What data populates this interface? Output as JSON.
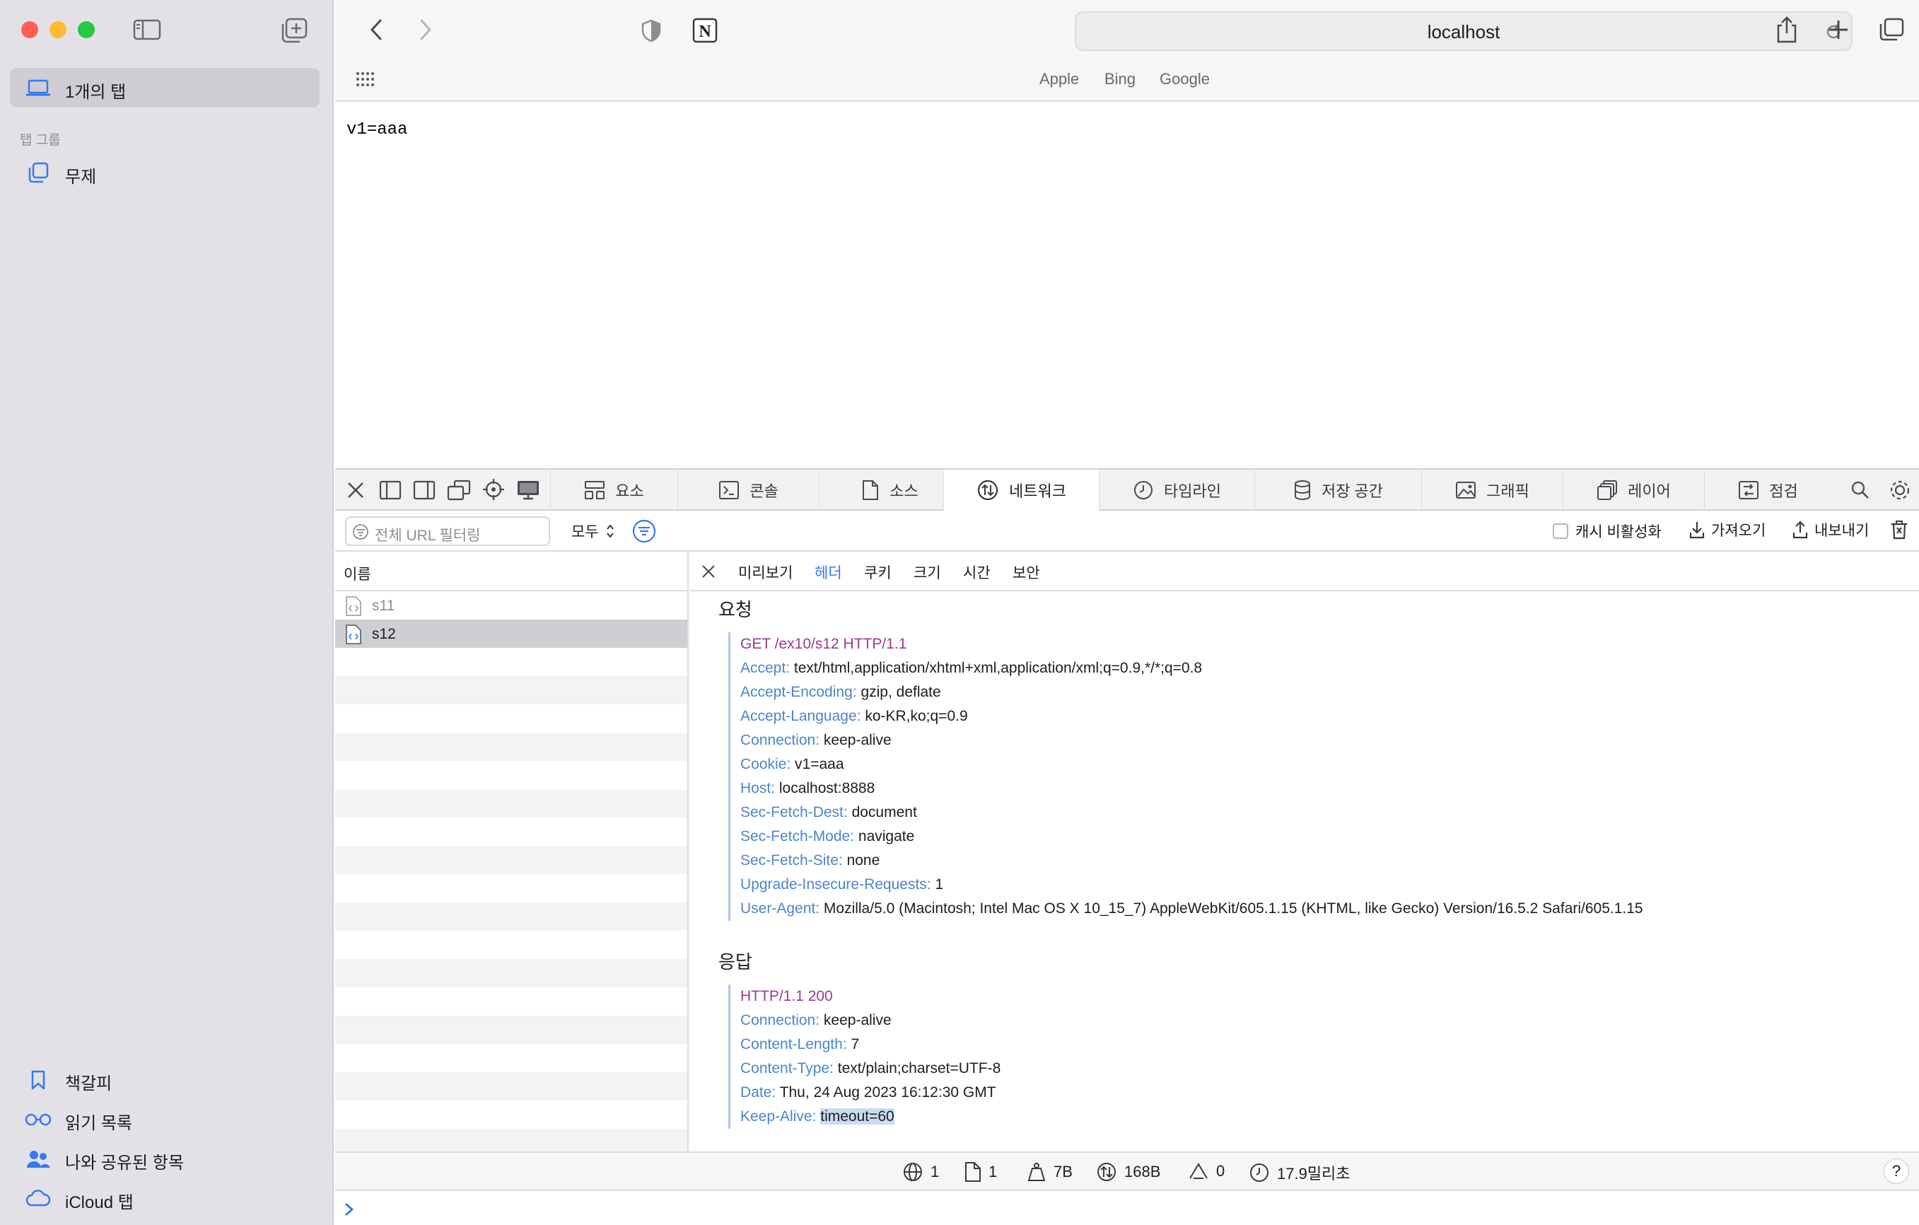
{
  "sidebar": {
    "tabs_label": "1개의 탭",
    "group_header": "탭 그룹",
    "group_item": "무제",
    "bottom": [
      "책갈피",
      "읽기 목록",
      "나와 공유된 항목",
      "iCloud 탭"
    ]
  },
  "toolbar": {
    "url": "localhost",
    "favorites": [
      "Apple",
      "Bing",
      "Google"
    ]
  },
  "page": {
    "content": "v1=aaa"
  },
  "inspector": {
    "tabs": [
      "요소",
      "콘솔",
      "소스",
      "네트워크",
      "타임라인",
      "저장 공간",
      "그래픽",
      "레이어",
      "점검"
    ],
    "active_tab": "네트워크",
    "filter_placeholder": "전체 URL 필터링",
    "type_select": "모두",
    "disable_cache": "캐시 비활성화",
    "import": "가져오기",
    "export": "내보내기",
    "name_header": "이름",
    "requests": [
      "s11",
      "s12"
    ],
    "selected_request": "s12",
    "detail_tabs": [
      "미리보기",
      "헤더",
      "쿠키",
      "크기",
      "시간",
      "보안"
    ],
    "active_detail_tab": "헤더",
    "request_title": "요청",
    "request_line": "GET /ex10/s12 HTTP/1.1",
    "request_headers": [
      {
        "k": "Accept:",
        "v": "text/html,application/xhtml+xml,application/xml;q=0.9,*/*;q=0.8"
      },
      {
        "k": "Accept-Encoding:",
        "v": "gzip, deflate"
      },
      {
        "k": "Accept-Language:",
        "v": "ko-KR,ko;q=0.9"
      },
      {
        "k": "Connection:",
        "v": "keep-alive"
      },
      {
        "k": "Cookie:",
        "v": "v1=aaa"
      },
      {
        "k": "Host:",
        "v": "localhost:8888"
      },
      {
        "k": "Sec-Fetch-Dest:",
        "v": "document"
      },
      {
        "k": "Sec-Fetch-Mode:",
        "v": "navigate"
      },
      {
        "k": "Sec-Fetch-Site:",
        "v": "none"
      },
      {
        "k": "Upgrade-Insecure-Requests:",
        "v": "1"
      },
      {
        "k": "User-Agent:",
        "v": "Mozilla/5.0 (Macintosh; Intel Mac OS X 10_15_7) AppleWebKit/605.1.15 (KHTML, like Gecko) Version/16.5.2 Safari/605.1.15"
      }
    ],
    "response_title": "응답",
    "response_line": "HTTP/1.1 200",
    "response_headers": [
      {
        "k": "Connection:",
        "v": "keep-alive"
      },
      {
        "k": "Content-Length:",
        "v": "7"
      },
      {
        "k": "Content-Type:",
        "v": "text/plain;charset=UTF-8"
      },
      {
        "k": "Date:",
        "v": "Thu, 24 Aug 2023 16:12:30 GMT"
      },
      {
        "k": "Keep-Alive:",
        "v": "timeout=60"
      }
    ],
    "status": {
      "requests": "1",
      "resources": "1",
      "transferred": "7B",
      "size": "168B",
      "redirects": "0",
      "time": "17.9밀리초",
      "help": "?"
    }
  },
  "colors": {
    "accent": "#3478f6",
    "header_key": "#4b86c9",
    "request_line": "#9b3a8c"
  }
}
